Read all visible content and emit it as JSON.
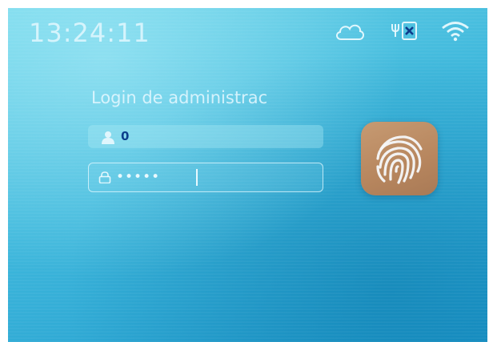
{
  "status_bar": {
    "time": "13:24:11",
    "icons": [
      "cloud-icon",
      "network-disconnected-icon",
      "wifi-icon"
    ]
  },
  "login": {
    "title": "Login de administrac",
    "user_id": "0",
    "password_mask": "•••••"
  },
  "fingerprint": {
    "icon": "fingerprint-icon"
  },
  "colors": {
    "background_top": "#6fd6ea",
    "background_bottom": "#1d98cc",
    "user_id_text": "#0c3f8c",
    "fingerprint_tile": "#b7865e"
  }
}
